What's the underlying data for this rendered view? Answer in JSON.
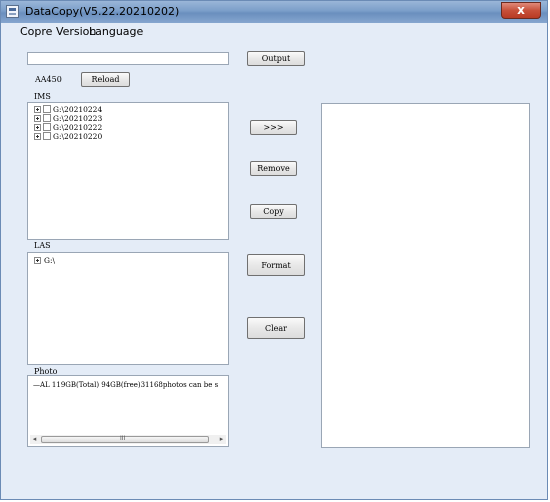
{
  "window": {
    "title": "DataCopy(V5.22.20210202)",
    "close_label": "x"
  },
  "menu": {
    "items": [
      "Copre Version",
      "Language"
    ]
  },
  "top": {
    "path_value": "",
    "output_label": "Output",
    "device_label": "AA450",
    "reload_label": "Reload"
  },
  "ims": {
    "label": "IMS",
    "items": [
      {
        "label": "G:\\20210224"
      },
      {
        "label": "G:\\20210223"
      },
      {
        "label": "G:\\20210222"
      },
      {
        "label": "G:\\20210220"
      }
    ]
  },
  "las": {
    "label": "LAS",
    "items": [
      {
        "label": "G:\\"
      }
    ]
  },
  "photo": {
    "label": "Photo",
    "line": "—AL 119GB(Total) 94GB(free)31168photos can be s",
    "thumb_grip": "III"
  },
  "actions": {
    "transfer_label": ">>>",
    "remove_label": "Remove",
    "copy_label": "Copy",
    "format_label": "Format",
    "clear_label": "Clear"
  }
}
